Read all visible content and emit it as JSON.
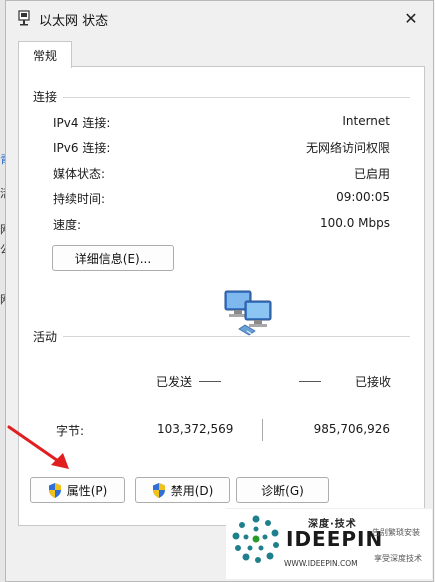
{
  "window": {
    "title": "以太网 状态",
    "close_glyph": "✕"
  },
  "tabs": [
    {
      "label": "常规"
    }
  ],
  "connection": {
    "group_label": "连接",
    "rows": [
      {
        "label": "IPv4 连接:",
        "value": "Internet"
      },
      {
        "label": "IPv6 连接:",
        "value": "无网络访问权限"
      },
      {
        "label": "媒体状态:",
        "value": "已启用"
      },
      {
        "label": "持续时间:",
        "value": "09:00:05"
      },
      {
        "label": "速度:",
        "value": "100.0 Mbps"
      }
    ],
    "details_button": "详细信息(E)..."
  },
  "activity": {
    "group_label": "活动",
    "sent_label": "已发送",
    "received_label": "已接收",
    "bytes_label": "字节:",
    "bytes_sent": "103,372,569",
    "bytes_received": "985,706,926",
    "icon": "network-computers-icon"
  },
  "buttons": {
    "properties": "属性(P)",
    "disable": "禁用(D)",
    "diagnose": "诊断(G)"
  },
  "background_fragments": [
    "青",
    "活",
    "网",
    "公",
    "网"
  ],
  "watermark": {
    "top": "深度·技术",
    "brand": "IDEEPIN",
    "url": "WWW.IDEEPIN.COM",
    "slogan1": "告别繁琐安装",
    "slogan2": "享受深度技术"
  },
  "colors": {
    "arrow": "#e02020",
    "shield_blue": "#2f6fd6",
    "shield_yellow": "#f2c21b",
    "logo_teal": "#1f7f8c"
  }
}
